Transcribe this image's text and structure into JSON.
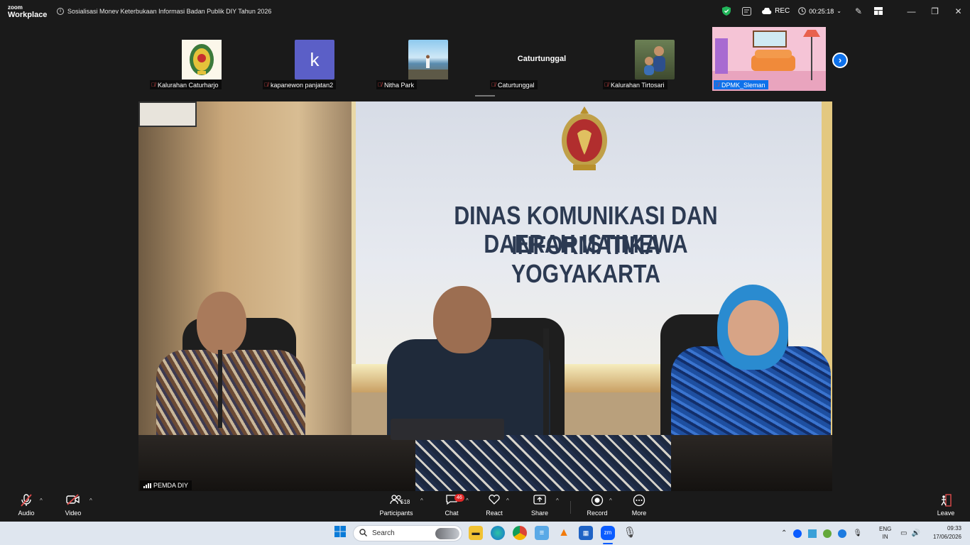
{
  "app": {
    "logo_line1": "zoom",
    "logo_line2": "Workplace"
  },
  "meeting": {
    "title": "Sosialisasi Monev Keterbukaan Informasi Badan Publik DIY Tahun 2026"
  },
  "titlebar": {
    "rec_label": "REC",
    "timer": "00:25:18"
  },
  "participants_strip": [
    {
      "name": "Kalurahan Caturharjo",
      "muted": true
    },
    {
      "name": "kapanewon panjatan2",
      "muted": true,
      "initial": "k"
    },
    {
      "name": "Nitha Park",
      "muted": true
    },
    {
      "name": "Caturtunggal",
      "muted": true,
      "display_text": "Caturtunggal"
    },
    {
      "name": "Kalurahan Tirtosari",
      "muted": true
    },
    {
      "name": "DPMK_Sleman",
      "muted": true
    }
  ],
  "main_video": {
    "speaker_name": "PEMDA DIY",
    "banner_line1": "DINAS KOMUNIKASI DAN INFORMATIKA",
    "banner_line2": "DAERAH ISTIMEWA YOGYAKARTA"
  },
  "toolbar": {
    "audio": "Audio",
    "video": "Video",
    "participants": "Participants",
    "participants_count": "518",
    "chat": "Chat",
    "chat_badge": "46",
    "react": "React",
    "share": "Share",
    "record": "Record",
    "more": "More",
    "leave": "Leave"
  },
  "taskbar": {
    "search_placeholder": "Search",
    "lang_line1": "ENG",
    "lang_line2": "IN",
    "time": "09:33",
    "date": "17/06/2026"
  },
  "colors": {
    "accent": "#0e71eb",
    "muted_red": "#e04b4b",
    "badge_red": "#e02828"
  }
}
